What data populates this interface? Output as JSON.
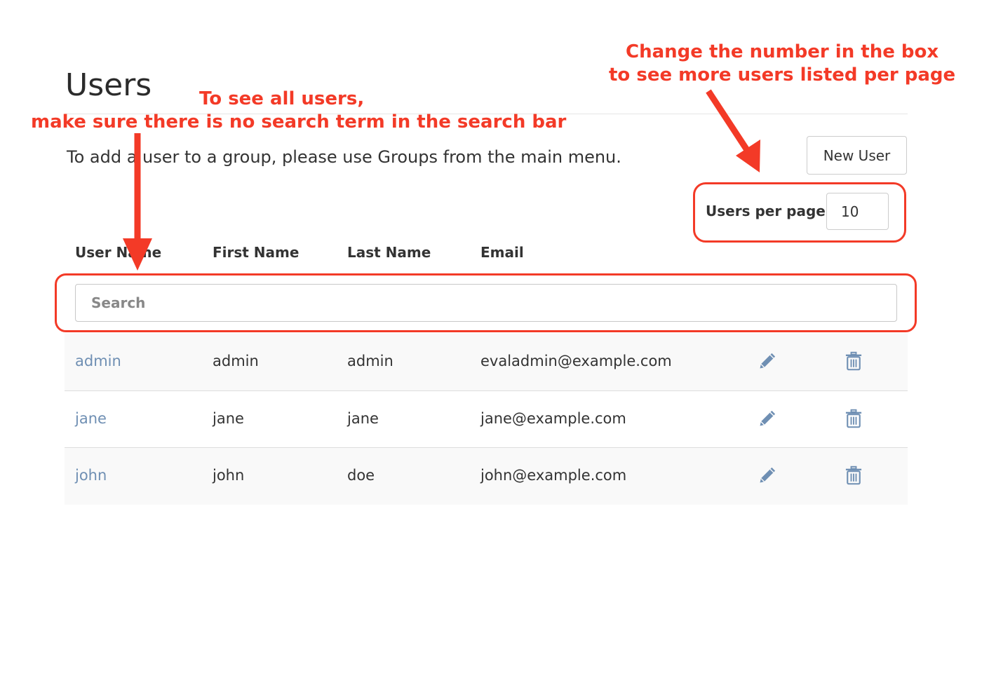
{
  "page": {
    "title": "Users",
    "instruction": "To add a user to a group, please use Groups from the main menu.",
    "new_user_label": "New User",
    "per_page_label": "Users per page:",
    "per_page_value": "10"
  },
  "table": {
    "columns": [
      "User Name",
      "First Name",
      "Last Name",
      "Email"
    ],
    "search_placeholder": "Search",
    "rows": [
      {
        "username": "admin",
        "first": "admin",
        "last": "admin",
        "email": "evaladmin@example.com"
      },
      {
        "username": "jane",
        "first": "jane",
        "last": "jane",
        "email": "jane@example.com"
      },
      {
        "username": "john",
        "first": "john",
        "last": "doe",
        "email": "john@example.com"
      }
    ],
    "edit_icon": "pencil-icon",
    "delete_icon": "trash-icon"
  },
  "annotations": {
    "search_line1": "To see all users,",
    "search_line2": "make sure there is no search term in the search bar",
    "per_page_line1": "Change the number in the box",
    "per_page_line2": "to see more users listed per page"
  },
  "colors": {
    "link": "#6f8fb3",
    "annotation": "#f33a27",
    "icon": "#6f8fb3"
  }
}
